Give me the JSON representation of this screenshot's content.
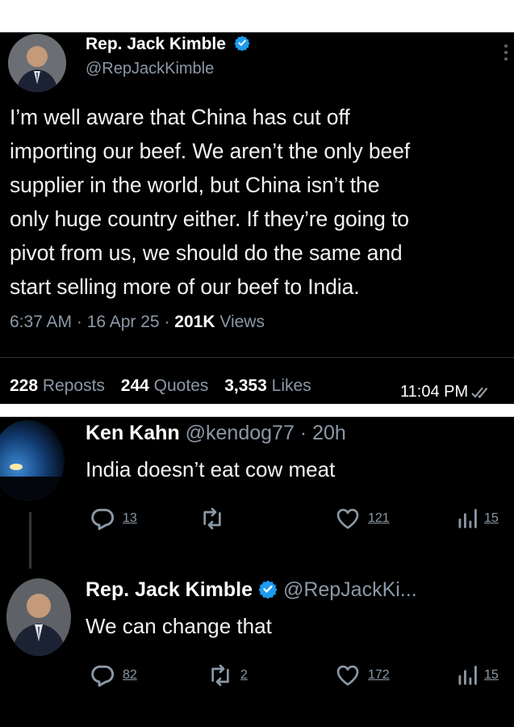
{
  "original_tweet": {
    "author_name": "Rep. Jack Kimble",
    "handle": "@RepJackKimble",
    "text_lines": [
      "I’m well aware that China has cut off",
      "importing our beef. We aren’t the only beef",
      "supplier in the world, but China isn’t the",
      "only huge country either. If they’re going to",
      "pivot from us, we should do the same and",
      "start selling more of our beef to India."
    ],
    "time": "6:37 AM · 16 Apr 25 · ",
    "views_count": "201K",
    "views_label": " Views",
    "reposts_count": "228",
    "reposts_label": "Reposts",
    "quotes_count": "244",
    "quotes_label": "Quotes",
    "likes_count": "3,353",
    "likes_label": "Likes",
    "screenshot_time": "11:04 PM"
  },
  "replies": [
    {
      "author_name": "Ken Kahn",
      "handle_time": "@kendog77 · 20h",
      "text": "India doesn’t eat cow meat",
      "replies_count": "13",
      "reposts_count": "",
      "likes_count": "121",
      "views_count": "15"
    },
    {
      "author_name": "Rep. Jack Kimble",
      "handle_time": "@RepJackKi...",
      "text": "We can change that",
      "replies_count": "82",
      "reposts_count": "2",
      "likes_count": "172",
      "views_count": "15"
    }
  ],
  "icons": [
    "verified-badge-icon",
    "more-icon",
    "reply-icon",
    "repost-icon",
    "like-icon",
    "views-icon",
    "read-receipt-icon"
  ],
  "colors": {
    "verified_blue": "#1d9bf0",
    "muted_text": "#8b98a5",
    "background": "#000000"
  }
}
